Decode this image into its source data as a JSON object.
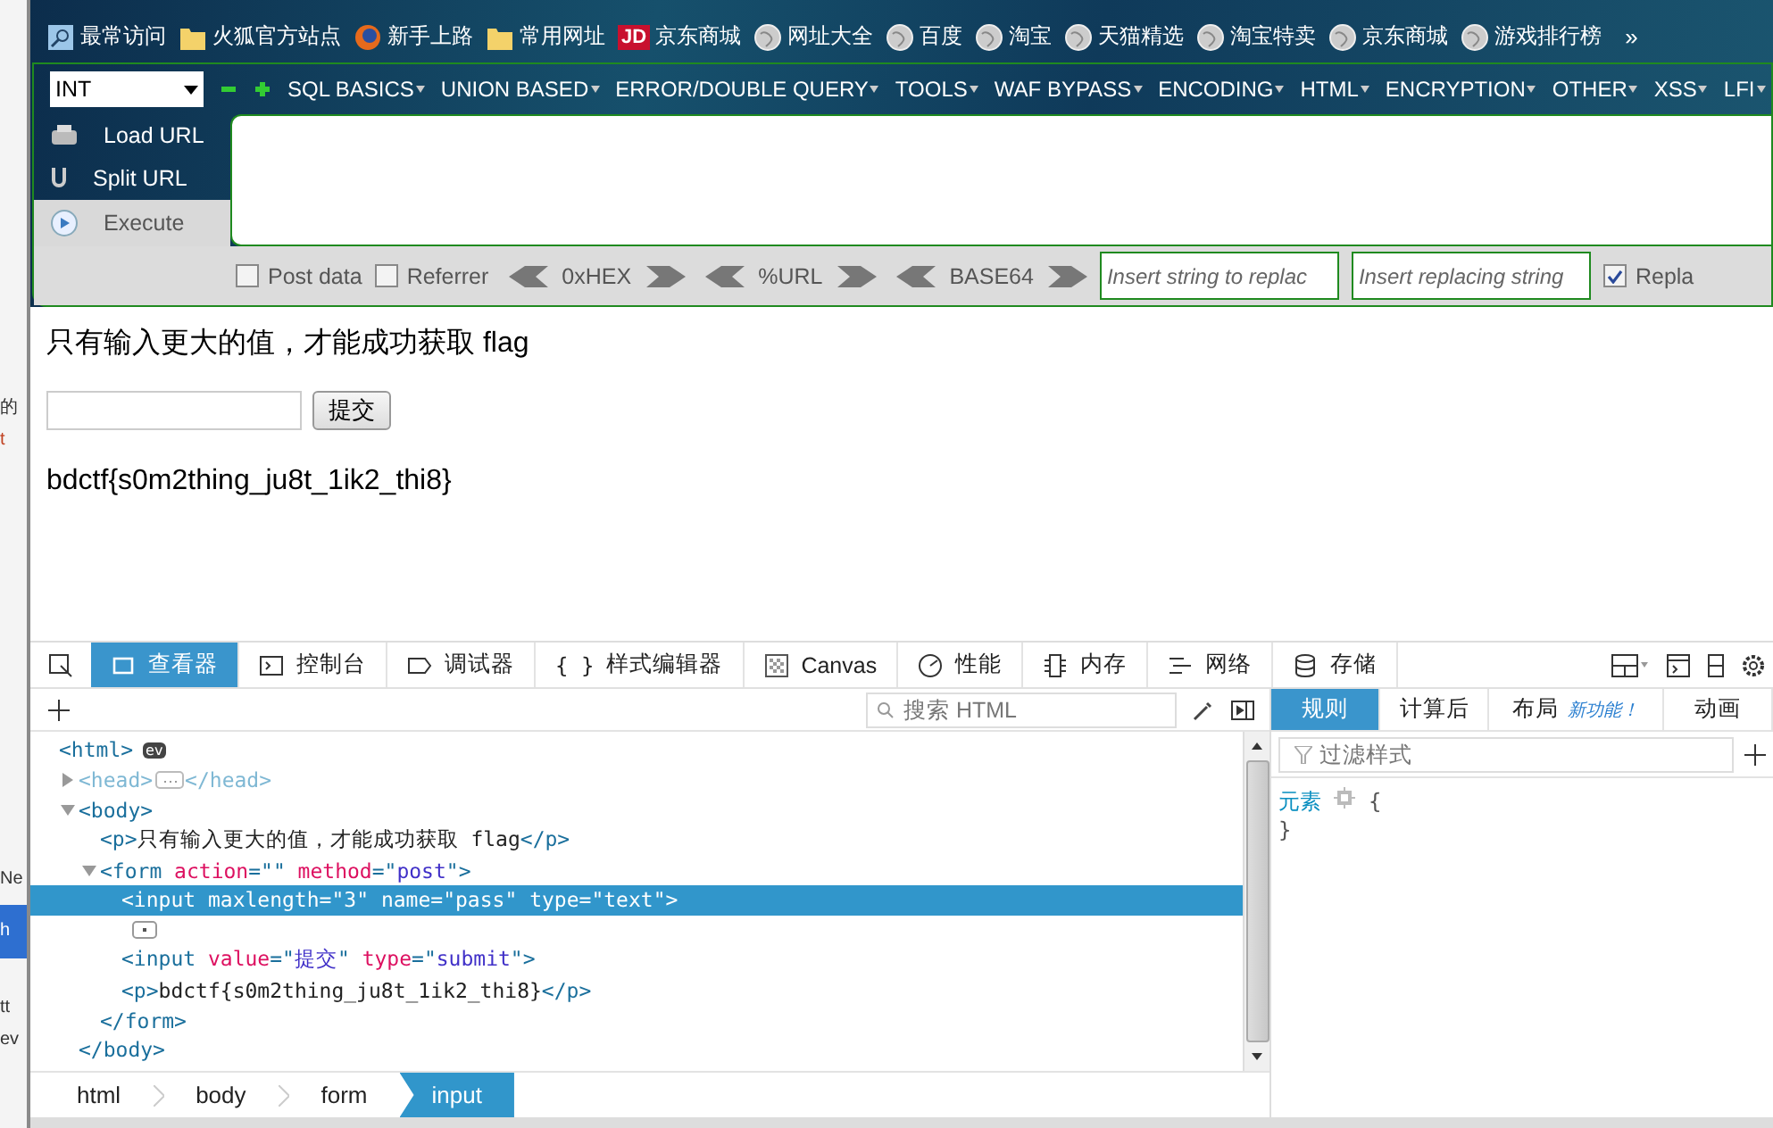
{
  "background_window": {
    "fragments": [
      {
        "text": "的",
        "kind": "plain"
      },
      {
        "text": "t",
        "kind": "code"
      },
      {
        "text": "Ne",
        "kind": "plain"
      },
      {
        "text": "h",
        "kind": "highlight"
      },
      {
        "text": "tt",
        "kind": "plain"
      },
      {
        "text": "ev",
        "kind": "plain"
      }
    ]
  },
  "bookmarks": {
    "items": [
      {
        "label": "最常访问",
        "kind": "search"
      },
      {
        "label": "火狐官方站点",
        "kind": "folder"
      },
      {
        "label": "新手上路",
        "kind": "firefox"
      },
      {
        "label": "常用网址",
        "kind": "folder"
      },
      {
        "label": "京东商城",
        "kind": "badge",
        "badge": "JD"
      },
      {
        "label": "网址大全",
        "kind": "globe"
      },
      {
        "label": "百度",
        "kind": "globe"
      },
      {
        "label": "淘宝",
        "kind": "globe"
      },
      {
        "label": "天猫精选",
        "kind": "globe"
      },
      {
        "label": "淘宝特卖",
        "kind": "globe"
      },
      {
        "label": "京东商城",
        "kind": "globe"
      },
      {
        "label": "游戏排行榜",
        "kind": "globe"
      }
    ],
    "overflow": "»"
  },
  "hackbar": {
    "select": "INT",
    "menus": [
      "SQL BASICS",
      "UNION BASED",
      "ERROR/DOUBLE QUERY",
      "TOOLS",
      "WAF BYPASS",
      "ENCODING",
      "HTML",
      "ENCRYPTION",
      "OTHER",
      "XSS",
      "LFI"
    ],
    "actions": [
      {
        "label": "Load URL",
        "kind": "load"
      },
      {
        "label": "Split URL",
        "kind": "split"
      },
      {
        "label": "Execute",
        "kind": "execute"
      }
    ],
    "options": [
      {
        "label": "Post data",
        "checked": false
      },
      {
        "label": "Referrer",
        "checked": false
      }
    ],
    "encoders": [
      "0xHEX",
      "%URL",
      "BASE64"
    ],
    "replace_fields": [
      {
        "placeholder": "Insert string to replac"
      },
      {
        "placeholder": "Insert replacing string"
      }
    ],
    "replace_all": {
      "label": "Repla",
      "checked": true
    }
  },
  "page": {
    "prompt": "只有输入更大的值，才能成功获取 flag",
    "submit": "提交",
    "flag": "bdctf{s0m2thing_ju8t_1ik2_thi8}"
  },
  "devtools": {
    "tabs": [
      {
        "label": "查看器",
        "kind": "inspector",
        "selected": true
      },
      {
        "label": "控制台",
        "kind": "console",
        "selected": false
      },
      {
        "label": "调试器",
        "kind": "debugger",
        "selected": false
      },
      {
        "label": "样式编辑器",
        "kind": "style",
        "glyph": "{ }",
        "selected": false
      },
      {
        "label": "Canvas",
        "kind": "canvas",
        "selected": false
      },
      {
        "label": "性能",
        "kind": "performance",
        "selected": false
      },
      {
        "label": "内存",
        "kind": "memory",
        "selected": false
      },
      {
        "label": "网络",
        "kind": "network",
        "selected": false
      },
      {
        "label": "存储",
        "kind": "storage",
        "selected": false
      }
    ],
    "search": {
      "placeholder": "搜索 HTML"
    },
    "tree": [
      {
        "open": [
          {
            "kind": "tag",
            "text": "<html>"
          }
        ],
        "badge": "ev",
        "children": [
          {
            "open": [
              {
                "kind": "tag",
                "text": "<head>"
              }
            ],
            "close": "</head>",
            "expanded": false,
            "dim": true
          },
          {
            "open": [
              {
                "kind": "tag",
                "text": "<body>"
              }
            ],
            "close": "</body>",
            "expanded": true,
            "children": [
              {
                "open": [
                  {
                    "kind": "tag",
                    "text": "<p>"
                  },
                  {
                    "kind": "text",
                    "text": "只有输入更大的值，才能成功获取 flag"
                  },
                  {
                    "kind": "tag",
                    "text": "</p>"
                  }
                ]
              },
              {
                "open": [
                  {
                    "kind": "tag",
                    "text": "<form "
                  },
                  {
                    "kind": "attr",
                    "text": "action"
                  },
                  {
                    "kind": "tag",
                    "text": "=\"\" "
                  },
                  {
                    "kind": "attr",
                    "text": "method"
                  },
                  {
                    "kind": "tag",
                    "text": "=\""
                  },
                  {
                    "kind": "value",
                    "text": "post"
                  },
                  {
                    "kind": "tag",
                    "text": "\">"
                  }
                ],
                "close": "</form>",
                "expanded": true,
                "children": [
                  {
                    "open": [
                      {
                        "kind": "tag",
                        "text": "<input "
                      },
                      {
                        "kind": "attr",
                        "text": "maxlength"
                      },
                      {
                        "kind": "tag",
                        "text": "=\""
                      },
                      {
                        "kind": "value",
                        "text": "3"
                      },
                      {
                        "kind": "tag",
                        "text": "\" "
                      },
                      {
                        "kind": "attr",
                        "text": "name"
                      },
                      {
                        "kind": "tag",
                        "text": "=\""
                      },
                      {
                        "kind": "value",
                        "text": "pass"
                      },
                      {
                        "kind": "tag",
                        "text": "\" "
                      },
                      {
                        "kind": "attr",
                        "text": "type"
                      },
                      {
                        "kind": "tag",
                        "text": "=\""
                      },
                      {
                        "kind": "value",
                        "text": "text"
                      },
                      {
                        "kind": "tag",
                        "text": "\">"
                      }
                    ],
                    "selected": true,
                    "pseudo": true
                  },
                  {
                    "open": [
                      {
                        "kind": "tag",
                        "text": "<input "
                      },
                      {
                        "kind": "attr",
                        "text": "value"
                      },
                      {
                        "kind": "tag",
                        "text": "=\""
                      },
                      {
                        "kind": "value",
                        "text": "提交"
                      },
                      {
                        "kind": "tag",
                        "text": "\" "
                      },
                      {
                        "kind": "attr",
                        "text": "type"
                      },
                      {
                        "kind": "tag",
                        "text": "=\""
                      },
                      {
                        "kind": "value",
                        "text": "submit"
                      },
                      {
                        "kind": "tag",
                        "text": "\">"
                      }
                    ],
                    "selected": false
                  },
                  {
                    "open": [
                      {
                        "kind": "tag",
                        "text": "<p>"
                      },
                      {
                        "kind": "text",
                        "text": "bdctf{s0m2thing_ju8t_1ik2_thi8}"
                      },
                      {
                        "kind": "tag",
                        "text": "</p>"
                      }
                    ],
                    "selected": false
                  }
                ]
              }
            ]
          }
        ]
      }
    ],
    "breadcrumbs": [
      {
        "label": "html",
        "selected": false
      },
      {
        "label": "body",
        "selected": false
      },
      {
        "label": "form",
        "selected": false
      },
      {
        "label": "input",
        "selected": true
      }
    ],
    "side_tabs": [
      {
        "label": "规则",
        "selected": true
      },
      {
        "label": "计算后",
        "selected": false
      },
      {
        "label": "布局",
        "badge": "新功能！",
        "selected": false
      },
      {
        "label": "动画",
        "selected": false
      }
    ],
    "filter": {
      "placeholder": "过滤样式"
    },
    "rule": {
      "selector": "元素",
      "open": "{",
      "close": "}"
    }
  }
}
